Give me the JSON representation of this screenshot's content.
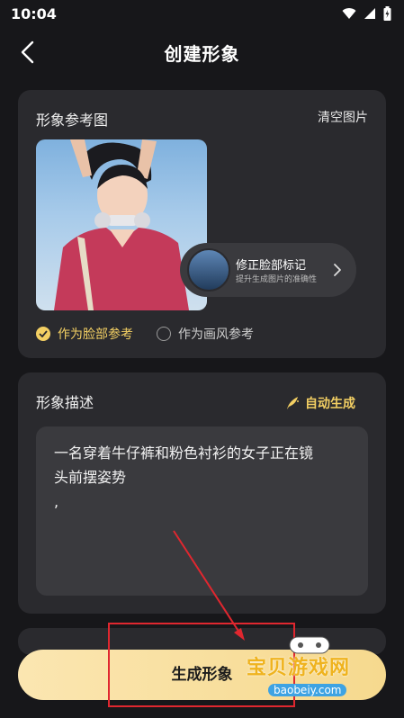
{
  "status": {
    "time": "10:04"
  },
  "header": {
    "title": "创建形象"
  },
  "reference": {
    "title": "形象参考图",
    "clear_label": "清空图片",
    "fix": {
      "title": "修正脸部标记",
      "subtitle": "提升生成图片的准确性"
    },
    "option_face": "作为脸部参考",
    "option_style": "作为画风参考"
  },
  "description": {
    "title": "形象描述",
    "auto_label": "自动生成",
    "text_line1": "一名穿着牛仔裤和粉色衬衫的女子正在镜",
    "text_line2": "头前摆姿势",
    "text_line3": ","
  },
  "generate_label": "生成形象",
  "watermark": {
    "text": "宝贝游戏网",
    "url": "baobeiy.com"
  },
  "colors": {
    "accent": "#f3cf63",
    "annotation": "#e0272f"
  }
}
